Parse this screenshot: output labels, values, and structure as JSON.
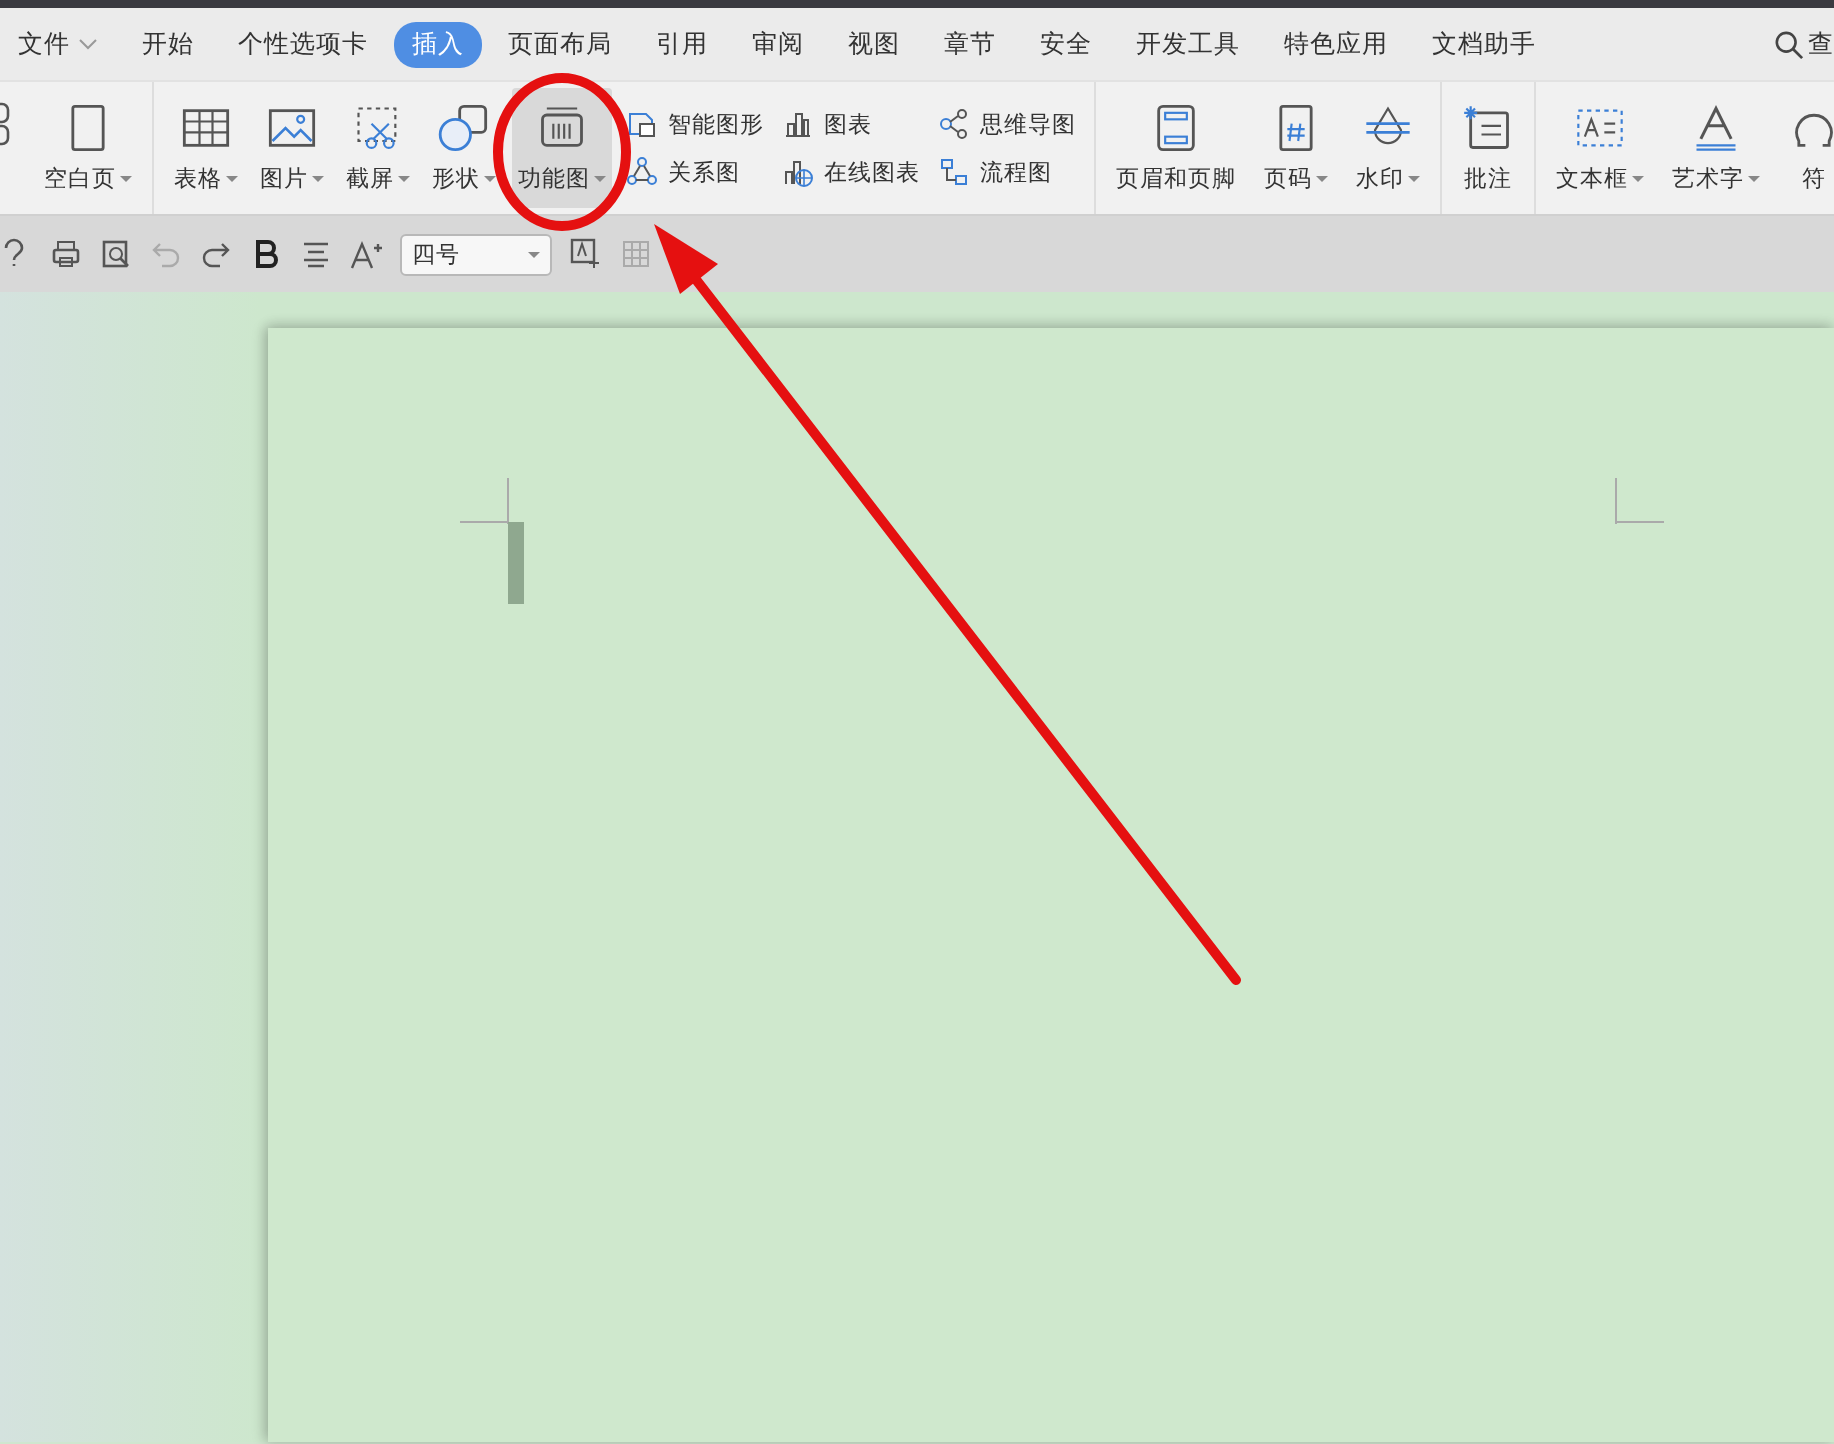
{
  "tabs": [
    {
      "label": "文件",
      "selected": false,
      "menu": true
    },
    {
      "label": "开始",
      "selected": false,
      "menu": false
    },
    {
      "label": "个性选项卡",
      "selected": false,
      "menu": false
    },
    {
      "label": "插入",
      "selected": true,
      "menu": false
    },
    {
      "label": "页面布局",
      "selected": false,
      "menu": false
    },
    {
      "label": "引用",
      "selected": false,
      "menu": false
    },
    {
      "label": "审阅",
      "selected": false,
      "menu": false
    },
    {
      "label": "视图",
      "selected": false,
      "menu": false
    },
    {
      "label": "章节",
      "selected": false,
      "menu": false
    },
    {
      "label": "安全",
      "selected": false,
      "menu": false
    },
    {
      "label": "开发工具",
      "selected": false,
      "menu": false
    },
    {
      "label": "特色应用",
      "selected": false,
      "menu": false
    },
    {
      "label": "文档助手",
      "selected": false,
      "menu": false
    }
  ],
  "search": {
    "label": "查"
  },
  "ribbon": {
    "groups": [
      {
        "items": [
          {
            "kind": "large",
            "label": "空白页",
            "dropdown": true,
            "highlighted": false
          }
        ]
      },
      {
        "items": [
          {
            "kind": "large",
            "label": "表格",
            "dropdown": true,
            "highlighted": false
          },
          {
            "kind": "large",
            "label": "图片",
            "dropdown": true,
            "highlighted": false
          },
          {
            "kind": "large",
            "label": "截屏",
            "dropdown": true,
            "highlighted": false
          },
          {
            "kind": "large",
            "label": "形状",
            "dropdown": true,
            "highlighted": false
          },
          {
            "kind": "large",
            "label": "功能图",
            "dropdown": true,
            "highlighted": true
          },
          {
            "kind": "stack",
            "items": [
              {
                "label": "智能图形"
              },
              {
                "label": "关系图"
              }
            ]
          },
          {
            "kind": "stack",
            "items": [
              {
                "label": "图表"
              },
              {
                "label": "在线图表"
              }
            ]
          },
          {
            "kind": "stack",
            "items": [
              {
                "label": "思维导图"
              },
              {
                "label": "流程图"
              }
            ]
          }
        ]
      },
      {
        "items": [
          {
            "kind": "large",
            "label": "页眉和页脚",
            "dropdown": false,
            "highlighted": false
          },
          {
            "kind": "large",
            "label": "页码",
            "dropdown": true,
            "highlighted": false
          },
          {
            "kind": "large",
            "label": "水印",
            "dropdown": true,
            "highlighted": false
          }
        ]
      },
      {
        "items": [
          {
            "kind": "large",
            "label": "批注",
            "dropdown": false,
            "highlighted": false
          }
        ]
      },
      {
        "items": [
          {
            "kind": "large",
            "label": "文本框",
            "dropdown": true,
            "highlighted": false
          },
          {
            "kind": "large",
            "label": "艺术字",
            "dropdown": true,
            "highlighted": false
          },
          {
            "kind": "large",
            "label": "符",
            "dropdown": false,
            "highlighted": false
          }
        ]
      }
    ]
  },
  "quick_toolbar": {
    "font_size": "四号"
  }
}
